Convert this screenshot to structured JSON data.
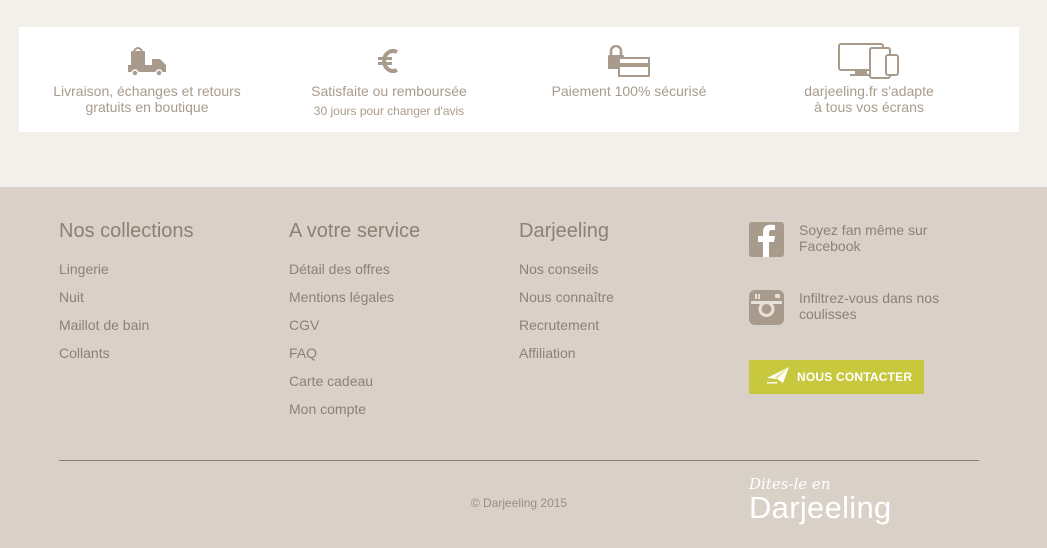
{
  "benefits": [
    {
      "icon": "delivery-truck-icon",
      "title": "Livraison, échanges et retours gratuits en boutique",
      "subtitle": ""
    },
    {
      "icon": "euro-icon",
      "title": "Satisfaite ou remboursée",
      "subtitle": "30 jours pour changer d'avis"
    },
    {
      "icon": "secure-payment-icon",
      "title": "Paiement 100% sécurisé",
      "subtitle": ""
    },
    {
      "icon": "devices-icon",
      "title": "darjeeling.fr s'adapte à tous vos écrans",
      "subtitle": ""
    }
  ],
  "footer": {
    "collections": {
      "heading": "Nos collections",
      "items": [
        "Lingerie",
        "Nuit",
        "Maillot de bain",
        "Collants"
      ]
    },
    "service": {
      "heading": "A votre service",
      "items": [
        "Détail des offres",
        "Mentions légales",
        "CGV",
        "FAQ",
        "Carte cadeau",
        "Mon compte"
      ]
    },
    "darjeeling": {
      "heading": "Darjeeling",
      "items": [
        "Nos conseils",
        "Nous connaître",
        "Recrutement",
        "Affiliation"
      ]
    },
    "social": {
      "facebook": {
        "icon": "facebook-icon",
        "text": "Soyez fan même sur Facebook"
      },
      "instagram": {
        "icon": "instagram-icon",
        "text": "Infiltrez-vous dans nos coulisses"
      }
    },
    "contact_button": {
      "icon": "paper-plane-icon",
      "label": "NOUS CONTACTER"
    },
    "copyright": "© Darjeeling 2015",
    "brand": {
      "tagline": "Dites-le en",
      "name": "Darjeeling"
    }
  },
  "colors": {
    "page_bg": "#f3f0eb",
    "footer_bg": "#d9d0c8",
    "text": "#8e8174",
    "accent": "#c8c83f"
  }
}
